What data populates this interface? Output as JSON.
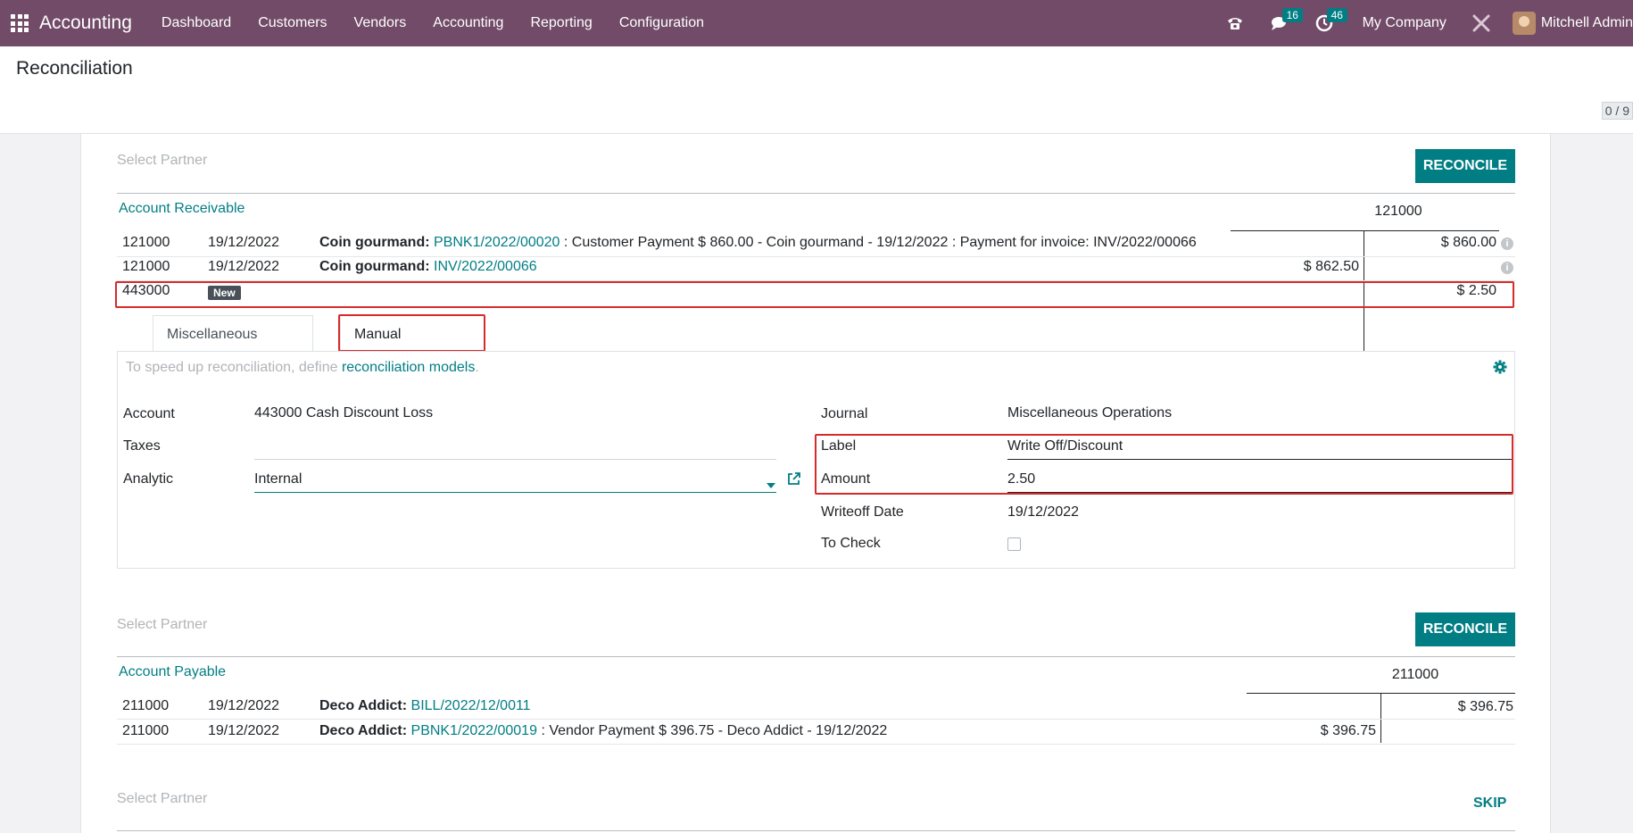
{
  "navbar": {
    "brand": "Accounting",
    "menu": [
      "Dashboard",
      "Customers",
      "Vendors",
      "Accounting",
      "Reporting",
      "Configuration"
    ],
    "messages_count": "16",
    "activities_count": "46",
    "company": "My Company",
    "user": "Mitchell Admin"
  },
  "page": {
    "title": "Reconciliation",
    "pager": "0 / 9"
  },
  "block1": {
    "partner_placeholder": "Select Partner",
    "reconcile_label": "RECONCILE",
    "account_title": "Account Receivable",
    "account_code_header": "121000",
    "lines": [
      {
        "account": "121000",
        "date": "19/12/2022",
        "partner": "Coin gourmand",
        "ref": "PBNK1/2022/00020",
        "desc": ": Customer Payment $ 860.00 - Coin gourmand - 19/12/2022 : Payment for invoice: INV/2022/00066",
        "debit": "",
        "credit": "$ 860.00"
      },
      {
        "account": "121000",
        "date": "19/12/2022",
        "partner": "Coin gourmand",
        "ref": "INV/2022/00066",
        "desc": "",
        "debit": "$ 862.50",
        "credit": ""
      },
      {
        "account": "443000",
        "badge": "New",
        "credit": "$ 2.50"
      }
    ],
    "tabs": [
      "Miscellaneous Matching",
      "Manual Operations"
    ],
    "hint_prefix": "To speed up reconciliation, define ",
    "hint_link": "reconciliation models",
    "hint_suffix": ".",
    "form": {
      "account_label": "Account",
      "account_value": "443000 Cash Discount Loss",
      "taxes_label": "Taxes",
      "taxes_value": "",
      "analytic_label": "Analytic",
      "analytic_value": "Internal",
      "journal_label": "Journal",
      "journal_value": "Miscellaneous Operations",
      "label_label": "Label",
      "label_value": "Write Off/Discount",
      "amount_label": "Amount",
      "amount_value": "2.50",
      "writeoff_label": "Writeoff Date",
      "writeoff_value": "19/12/2022",
      "tocheck_label": "To Check"
    }
  },
  "block2": {
    "partner_placeholder": "Select Partner",
    "reconcile_label": "RECONCILE",
    "account_title": "Account Payable",
    "account_code_header": "211000",
    "lines": [
      {
        "account": "211000",
        "date": "19/12/2022",
        "partner": "Deco Addict",
        "ref": "BILL/2022/12/0011",
        "desc": "",
        "debit": "",
        "credit": "$ 396.75"
      },
      {
        "account": "211000",
        "date": "19/12/2022",
        "partner": "Deco Addict",
        "ref": "PBNK1/2022/00019",
        "desc": ": Vendor Payment $ 396.75 - Deco Addict - 19/12/2022",
        "debit": "$ 396.75",
        "credit": ""
      }
    ]
  },
  "block3": {
    "partner_placeholder": "Select Partner",
    "skip_label": "SKIP"
  }
}
